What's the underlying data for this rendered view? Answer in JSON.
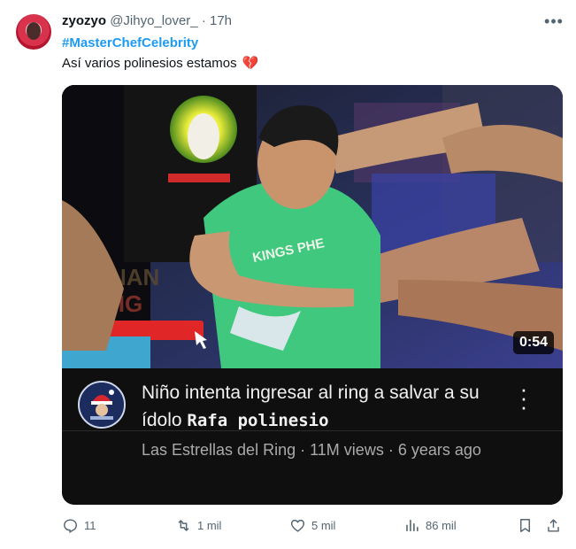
{
  "tweet": {
    "display_name": "zyozyo",
    "handle": "@Jihyo_lover_",
    "separator": "·",
    "time": "17h",
    "hashtag": "#MasterChefCelebrity",
    "text": "Así varios polinesios estamos",
    "emoji": "💔"
  },
  "video": {
    "duration": "0:54",
    "title_part1": "Niño intenta ingresar al ring a salvar a su ídolo",
    "title_part2": "Rafa polinesio",
    "channel": "Las Estrellas del Ring",
    "views": "11M views",
    "age": "6 years ago",
    "dot": "·",
    "shirt_text": "KINGS PHE"
  },
  "actions": {
    "replies": "11",
    "reposts": "1 mil",
    "likes": "5 mil",
    "views": "86 mil"
  },
  "colors": {
    "accent": "#1d9bf0",
    "muted": "#536471",
    "heart": "#e0245e"
  }
}
